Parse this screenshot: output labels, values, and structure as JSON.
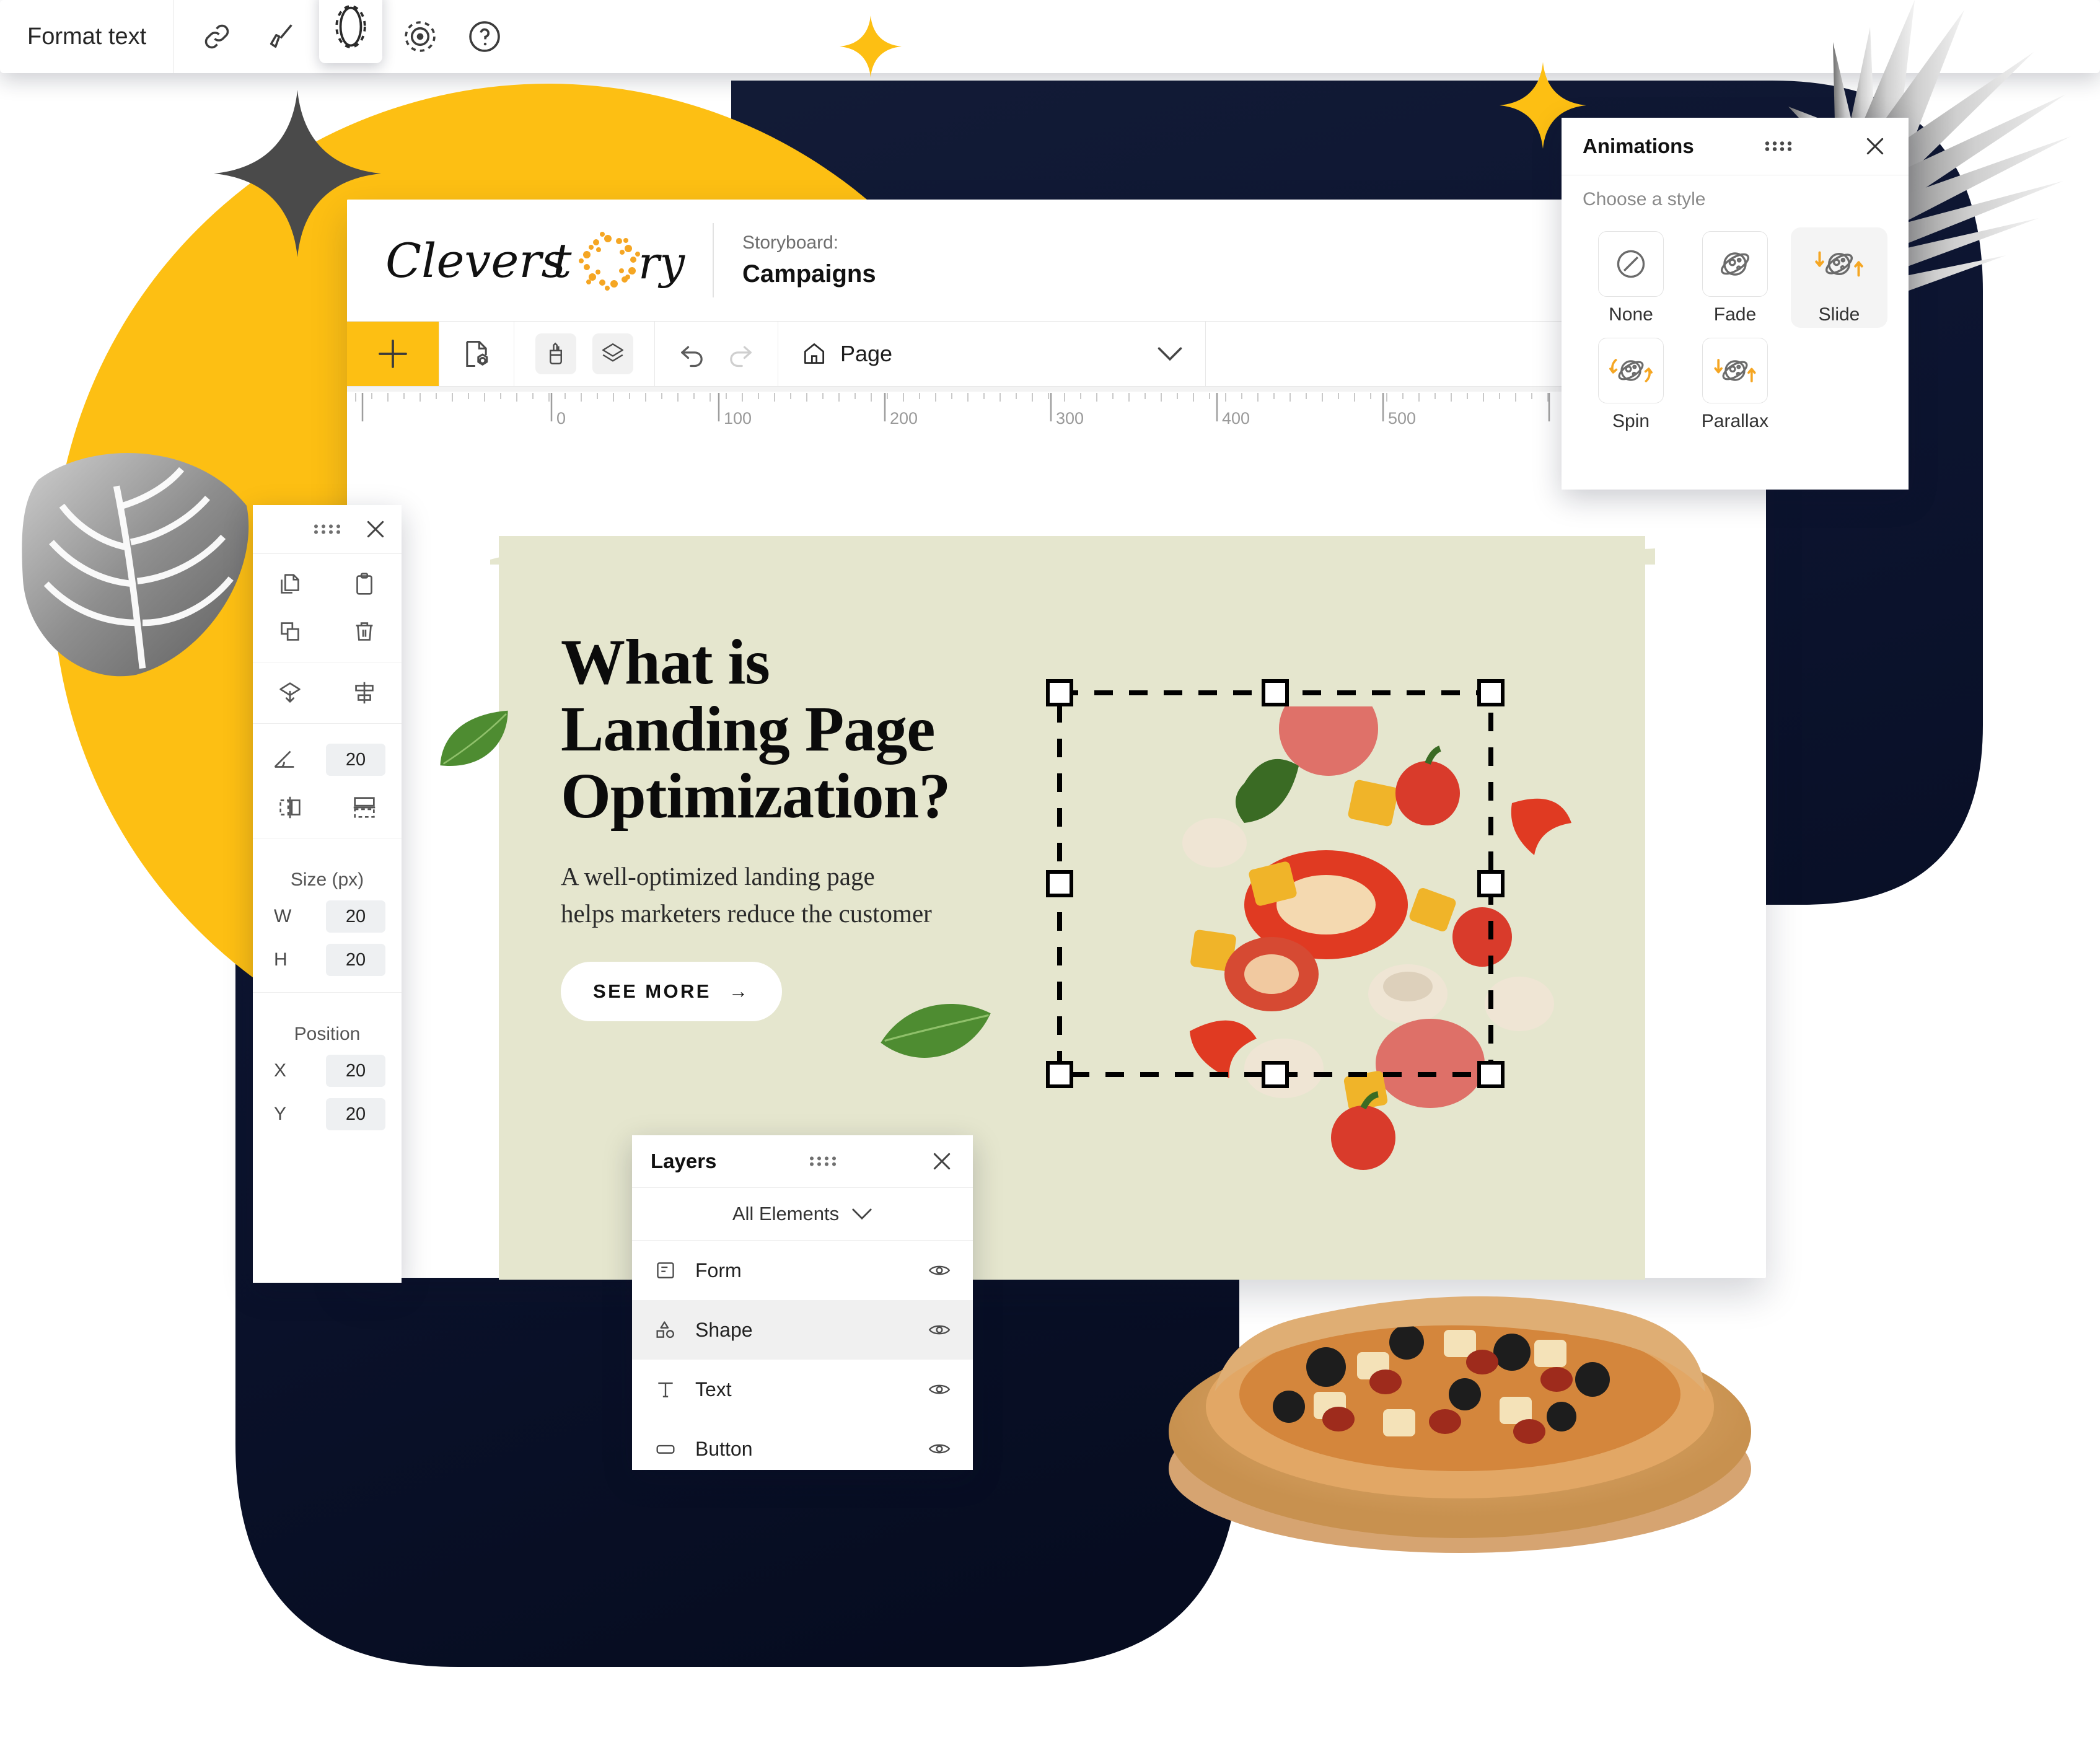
{
  "app": {
    "logo_text": "Cleverstory",
    "storyboard": {
      "label": "Storyboard:",
      "value": "Campaigns"
    },
    "toolbar": {
      "add_label": "+",
      "page_label": "Page",
      "icons": [
        "add-icon",
        "page-settings-icon",
        "pencil-cup-icon",
        "layers-stack-icon",
        "undo-icon",
        "redo-icon",
        "home-icon",
        "chevron-down-icon"
      ]
    },
    "ruler": {
      "unit": "px",
      "ticks": [
        "0",
        "100",
        "200",
        "300",
        "400",
        "500"
      ]
    }
  },
  "content": {
    "headline_line1": "What is",
    "headline_line2": "Landing Page",
    "headline_line3": "Optimization?",
    "sub_line1": "A well-optimized landing page",
    "sub_line2": "helps marketers reduce the customer",
    "cta_label": "SEE MORE",
    "cta_arrow": "→"
  },
  "properties_panel": {
    "icons": [
      "copy-icon",
      "paste-icon",
      "duplicate-icon",
      "delete-icon",
      "send-backward-icon",
      "align-center-icon",
      "rotate-icon",
      "flip-horizontal-icon",
      "flip-vertical-icon"
    ],
    "rotation_value": "20",
    "size_title": "Size (px)",
    "width_label": "W",
    "width_value": "20",
    "height_label": "H",
    "height_value": "20",
    "position_title": "Position",
    "x_label": "X",
    "x_value": "20",
    "y_label": "Y",
    "y_value": "20"
  },
  "layers_panel": {
    "title": "Layers",
    "filter_label": "All Elements",
    "items": [
      {
        "name": "Form",
        "icon": "form-icon",
        "selected": false,
        "visibility_icon": "eye-icon"
      },
      {
        "name": "Shape",
        "icon": "shape-icon",
        "selected": true,
        "visibility_icon": "eye-icon"
      },
      {
        "name": "Text",
        "icon": "text-icon",
        "selected": false,
        "visibility_icon": "eye-icon"
      },
      {
        "name": "Button",
        "icon": "button-icon",
        "selected": false,
        "visibility_icon": "eye-icon"
      }
    ]
  },
  "animations_panel": {
    "title": "Animations",
    "subtitle": "Choose a style",
    "options": [
      {
        "label": "None",
        "icon": "none-circle-slash-icon",
        "selected": false
      },
      {
        "label": "Fade",
        "icon": "planet-icon",
        "selected": false
      },
      {
        "label": "Slide",
        "icon": "planet-slide-icon",
        "selected": true
      },
      {
        "label": "Spin",
        "icon": "planet-spin-icon",
        "selected": false
      },
      {
        "label": "Parallax",
        "icon": "planet-parallax-icon",
        "selected": false
      }
    ]
  },
  "format_toolbar": {
    "label": "Format text",
    "buttons": [
      "link-icon",
      "brush-icon",
      "shape-outline-icon",
      "animation-target-icon",
      "help-icon"
    ],
    "active_index": 2
  },
  "colors": {
    "accent_yellow": "#FDBF13",
    "navy": "#0e1733",
    "card_beige": "#e5e6ce",
    "panel_white": "#ffffff",
    "text_dark": "#111111"
  }
}
